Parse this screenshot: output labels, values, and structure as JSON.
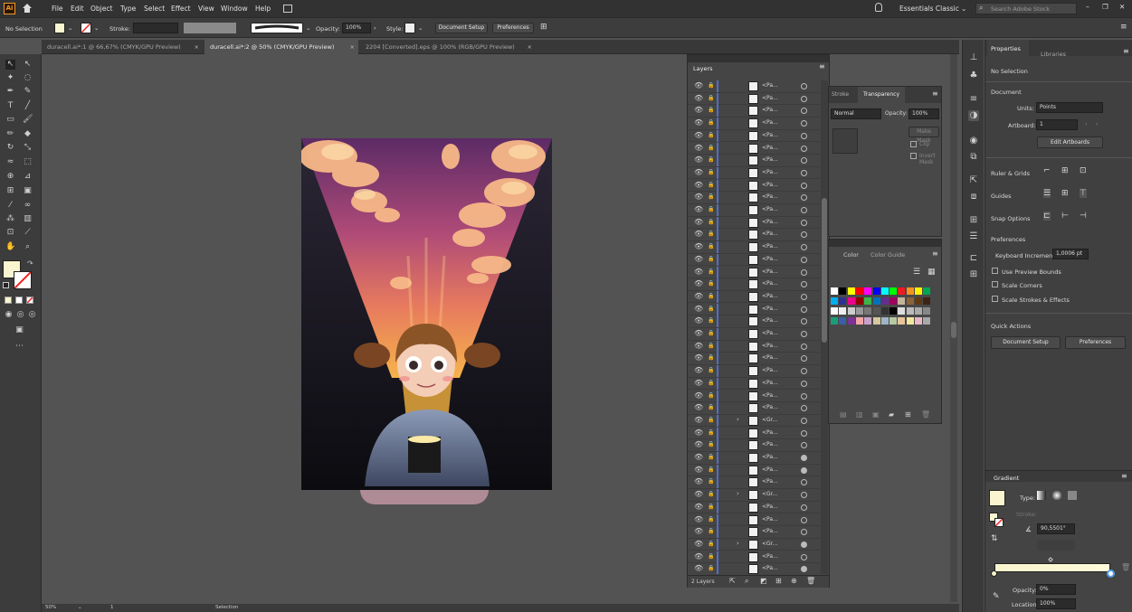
{
  "app": {
    "logo": "Ai"
  },
  "menu": [
    "File",
    "Edit",
    "Object",
    "Type",
    "Select",
    "Effect",
    "View",
    "Window",
    "Help"
  ],
  "workspace": "Essentials Classic",
  "search": {
    "placeholder": "Search Adobe Stock"
  },
  "control": {
    "selection": "No Selection",
    "stroke_label": "Stroke:",
    "opacity_label": "Opacity:",
    "opacity_value": "100%",
    "style_label": "Style:",
    "doc_setup": "Document Setup",
    "preferences": "Preferences"
  },
  "tabs": [
    {
      "label": "duracell.ai*:1 @ 66,67% (CMYK/GPU Preview)",
      "close": "×"
    },
    {
      "label": "duracell.ai*:2 @ 50% (CMYK/GPU Preview)",
      "close": "×"
    },
    {
      "label": "2204 [Converted].eps @ 100% (RGB/GPU Preview)",
      "close": "×"
    }
  ],
  "layers": {
    "title": "Layers",
    "footer": "2 Layers",
    "rows": [
      {
        "name": "<Pa...",
        "exp": "",
        "sel": false
      },
      {
        "name": "<Pa...",
        "exp": "",
        "sel": false
      },
      {
        "name": "<Pa...",
        "exp": "",
        "sel": false
      },
      {
        "name": "<Pa...",
        "exp": "",
        "sel": false
      },
      {
        "name": "<Pa...",
        "exp": "",
        "sel": false
      },
      {
        "name": "<Pa...",
        "exp": "",
        "sel": false
      },
      {
        "name": "<Pa...",
        "exp": "",
        "sel": false
      },
      {
        "name": "<Pa...",
        "exp": "",
        "sel": false
      },
      {
        "name": "<Pa...",
        "exp": "",
        "sel": false
      },
      {
        "name": "<Pa...",
        "exp": "",
        "sel": false
      },
      {
        "name": "<Pa...",
        "exp": "",
        "sel": false
      },
      {
        "name": "<Pa...",
        "exp": "",
        "sel": false
      },
      {
        "name": "<Pa...",
        "exp": "",
        "sel": false
      },
      {
        "name": "<Pa...",
        "exp": "",
        "sel": false
      },
      {
        "name": "<Pa...",
        "exp": "",
        "sel": false
      },
      {
        "name": "<Pa...",
        "exp": "",
        "sel": false
      },
      {
        "name": "<Pa...",
        "exp": "",
        "sel": false
      },
      {
        "name": "<Pa...",
        "exp": "",
        "sel": false
      },
      {
        "name": "<Pa...",
        "exp": "",
        "sel": false
      },
      {
        "name": "<Pa...",
        "exp": "",
        "sel": false
      },
      {
        "name": "<Pa...",
        "exp": "",
        "sel": false
      },
      {
        "name": "<Pa...",
        "exp": "",
        "sel": false
      },
      {
        "name": "<Pa...",
        "exp": "",
        "sel": false
      },
      {
        "name": "<Pa...",
        "exp": "",
        "sel": false
      },
      {
        "name": "<Pa...",
        "exp": "",
        "sel": false
      },
      {
        "name": "<Pa...",
        "exp": "",
        "sel": false
      },
      {
        "name": "<Pa...",
        "exp": "",
        "sel": false
      },
      {
        "name": "<Gr...",
        "exp": "›",
        "sel": false
      },
      {
        "name": "<Pa...",
        "exp": "",
        "sel": false
      },
      {
        "name": "<Pa...",
        "exp": "",
        "sel": false
      },
      {
        "name": "<Pa...",
        "exp": "",
        "sel": true
      },
      {
        "name": "<Pa...",
        "exp": "",
        "sel": true
      },
      {
        "name": "<Pa...",
        "exp": "",
        "sel": false
      },
      {
        "name": "<Gr...",
        "exp": "›",
        "sel": false
      },
      {
        "name": "<Pa...",
        "exp": "",
        "sel": false
      },
      {
        "name": "<Pa...",
        "exp": "",
        "sel": false
      },
      {
        "name": "<Pa...",
        "exp": "",
        "sel": false
      },
      {
        "name": "<Gr...",
        "exp": "›",
        "sel": true
      },
      {
        "name": "<Pa...",
        "exp": "",
        "sel": false
      },
      {
        "name": "<Pa...",
        "exp": "",
        "sel": true
      }
    ]
  },
  "transparency": {
    "tab_stroke": "Stroke",
    "tab_transparency": "Transparency",
    "mode": "Normal",
    "opacity_label": "Opacity:",
    "opacity": "100%",
    "make_mask": "Make Mask",
    "clip": "Clip",
    "invert": "Invert Mask"
  },
  "color": {
    "tab_color": "Color",
    "tab_guide": "Color Guide"
  },
  "properties": {
    "tab_props": "Properties",
    "tab_libs": "Libraries",
    "selection": "No Selection",
    "document": "Document",
    "units_label": "Units:",
    "units": "Points",
    "artboard_label": "Artboard:",
    "artboard": "1",
    "edit_artboards": "Edit Artboards",
    "ruler_grids": "Ruler & Grids",
    "guides": "Guides",
    "snap": "Snap Options",
    "preferences": "Preferences",
    "kbd_label": "Keyboard Increment:",
    "kbd_value": "1,0006 pt",
    "cb1": "Use Preview Bounds",
    "cb2": "Scale Corners",
    "cb3": "Scale Strokes & Effects",
    "quick": "Quick Actions",
    "doc_setup": "Document Setup",
    "prefs_btn": "Preferences"
  },
  "gradient": {
    "title": "Gradient",
    "type_label": "Type:",
    "stroke_label": "Stroke:",
    "angle": "90,5501°",
    "opacity_label": "Opacity:",
    "opacity": "0%",
    "location_label": "Location:",
    "location": "100%"
  },
  "status": {
    "zoom": "50%",
    "artboard": "1",
    "tool": "Selection"
  },
  "colors": {
    "accent": "#4f6ec8",
    "orange": "#f29b30"
  }
}
